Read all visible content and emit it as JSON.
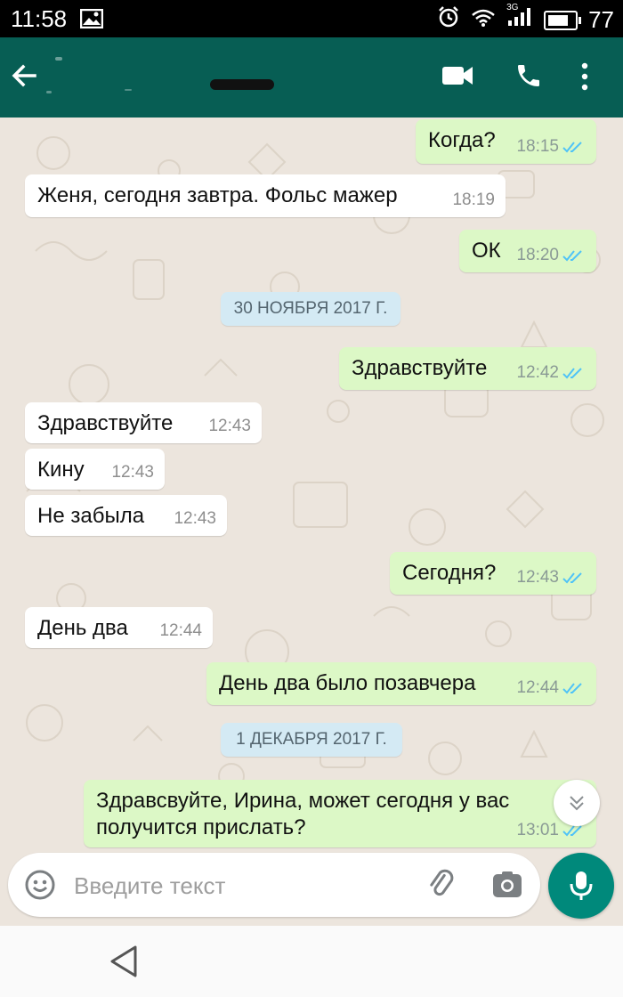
{
  "status_bar": {
    "time": "11:58",
    "network": "3G",
    "battery": "77"
  },
  "header": {
    "contact_name": ""
  },
  "messages": [
    {
      "direction": "out",
      "text": "Когда?",
      "time": "18:15",
      "read": true
    },
    {
      "direction": "in",
      "text": "Женя, сегодня завтра. Фольс мажер",
      "time": "18:19"
    },
    {
      "direction": "out",
      "text": "ОК",
      "time": "18:20",
      "read": true
    },
    {
      "type": "date",
      "text": "30 НОЯБРЯ 2017 Г."
    },
    {
      "direction": "out",
      "text": "Здравствуйте",
      "time": "12:42",
      "read": true
    },
    {
      "direction": "in",
      "text": "Здравствуйте",
      "time": "12:43"
    },
    {
      "direction": "in",
      "text": "Кину",
      "time": "12:43"
    },
    {
      "direction": "in",
      "text": "Не забыла",
      "time": "12:43"
    },
    {
      "direction": "out",
      "text": "Сегодня?",
      "time": "12:43",
      "read": true
    },
    {
      "direction": "in",
      "text": "День два",
      "time": "12:44"
    },
    {
      "direction": "out",
      "text": "День два было позавчера",
      "time": "12:44",
      "read": true
    },
    {
      "type": "date",
      "text": "1 ДЕКАБРЯ 2017 Г."
    },
    {
      "direction": "out",
      "text_line1": "Здравсвуйте, Ирина, может сегодня у вас",
      "text_line2": "получится прислать?",
      "time": "13:01",
      "read": true
    }
  ],
  "input": {
    "placeholder": "Введите текст"
  },
  "colors": {
    "header": "#075e54",
    "chat_bg": "#ece5dd",
    "outgoing": "#dcf8c6",
    "incoming": "#ffffff",
    "read_ticks": "#4fc3f7",
    "mic_button": "#00897b",
    "date_chip": "#d4eaf4"
  }
}
